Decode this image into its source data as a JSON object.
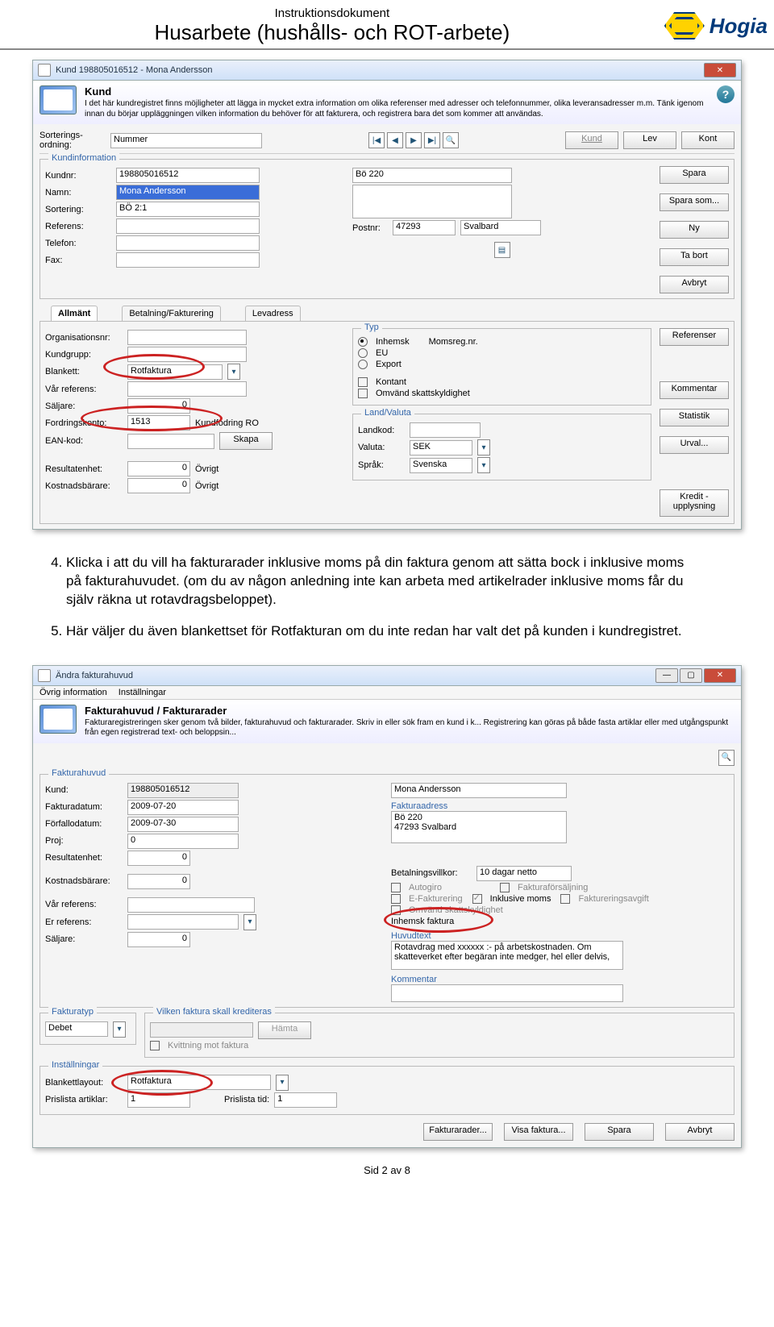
{
  "header": {
    "small": "Instruktionsdokument",
    "big": "Husarbete (hushålls- och ROT-arbete)",
    "brand": "Hogia"
  },
  "body": {
    "item4": "Klicka i att du vill ha fakturarader inklusive moms på din faktura genom att sätta bock i inklusive moms på fakturahuvudet. (om du av någon anledning inte kan arbeta med artikelrader inklusive moms får du själv räkna ut rotavdragsbeloppet).",
    "item5": "Här väljer du även blankettset för Rotfakturan om du inte redan har valt det på kunden i kundregistret."
  },
  "win1": {
    "title": "Kund 198805016512 - Mona Andersson",
    "info_h": "Kund",
    "info_p": "I det här kundregistret finns möjligheter att lägga in mycket extra information om olika referenser med adresser och telefonnummer, olika leveransadresser m.m. Tänk igenom innan du börjar uppläggningen vilken information du behöver för att fakturera, och registrera bara det som kommer att användas.",
    "sort_label": "Sorterings-\nordning:",
    "sort_val": "Nummer",
    "btn_kund": "Kund",
    "btn_lev": "Lev",
    "btn_kont": "Kont",
    "kundinfo": "Kundinformation",
    "kundnr_l": "Kundnr:",
    "kundnr_v": "198805016512",
    "namn_l": "Namn:",
    "namn_v": "Mona Andersson",
    "sortering_l": "Sortering:",
    "sortering_v": "BÖ 2:1",
    "referens_l": "Referens:",
    "telefon_l": "Telefon:",
    "postnr_l": "Postnr:",
    "postnr_v": "47293",
    "post_ort": "Svalbard",
    "fax_l": "Fax:",
    "addr1": "Bö 220",
    "btn_spara": "Spara",
    "btn_spara_som": "Spara som...",
    "btn_ny": "Ny",
    "btn_tabort": "Ta bort",
    "btn_avbryt": "Avbryt",
    "btn_referenser": "Referenser",
    "btn_kommentar": "Kommentar",
    "btn_statistik": "Statistik",
    "btn_urval": "Urval...",
    "btn_kredit": "Kredit -\nupplysning",
    "tab_allmant": "Allmänt",
    "tab_bet": "Betalning/Fakturering",
    "tab_levadr": "Levadress",
    "org_l": "Organisationsnr:",
    "kundgrupp_l": "Kundgrupp:",
    "blankett_l": "Blankett:",
    "blankett_v": "Rotfaktura",
    "varref_l": "Vår referens:",
    "saljare_l": "Säljare:",
    "saljare_v": "0",
    "fordring_l": "Fordringskonto:",
    "fordring_v": "1513",
    "fordring_t": "Kundfodring RO",
    "ean_l": "EAN-kod:",
    "btn_skapa": "Skapa",
    "resultat_l": "Resultatenhet:",
    "resultat_v": "0",
    "ovrigt": "Övrigt",
    "kostnad_l": "Kostnadsbärare:",
    "kostnad_v": "0",
    "typ_legend": "Typ",
    "r_inhemsk": "Inhemsk",
    "r_eu": "EU",
    "r_export": "Export",
    "momsreg": "Momsreg.nr.",
    "chk_kontant": "Kontant",
    "chk_omv": "Omvänd skattskyldighet",
    "land_legend": "Land/Valuta",
    "landkod_l": "Landkod:",
    "valuta_l": "Valuta:",
    "valuta_v": "SEK",
    "sprak_l": "Språk:",
    "sprak_v": "Svenska"
  },
  "win2": {
    "title": "Ändra fakturahuvud",
    "menu1": "Övrig information",
    "menu2": "Inställningar",
    "info_h": "Fakturahuvud / Fakturarader",
    "info_p": "Fakturaregistreringen sker genom två bilder, fakturahuvud och fakturarader. Skriv in eller sök fram en kund i k... Registrering kan göras på både fasta artiklar eller med utgångspunkt från egen registrerad text- och beloppsin...",
    "fh_legend": "Fakturahuvud",
    "kund_l": "Kund:",
    "kund_v": "198805016512",
    "kund_namn": "Mona Andersson",
    "fdat_l": "Fakturadatum:",
    "fdat_v": "2009-07-20",
    "ffdat_l": "Förfallodatum:",
    "ffdat_v": "2009-07-30",
    "proj_l": "Proj:",
    "proj_v": "0",
    "resultat_l": "Resultatenhet:",
    "resultat_v": "0",
    "kostnad_l": "Kostnadsbärare:",
    "kostnad_v": "0",
    "varref_l": "Vår referens:",
    "erref_l": "Er referens:",
    "saljare_l": "Säljare:",
    "saljare_v": "0",
    "faktadr_l": "Fakturaadress",
    "faktadr_v": "Bö 220\n47293 Svalbard",
    "betv_l": "Betalningsvillkor:",
    "betv_v": "10 dagar netto",
    "c_autogiro": "Autogiro",
    "c_efakt": "E-Fakturering",
    "c_inkl": "Inklusive moms",
    "c_omv": "Omvänd skattskyldighet",
    "c_ffors": "Fakturaförsäljning",
    "c_favg": "Faktureringsavgift",
    "inhemsk": "Inhemsk faktura",
    "huvudtext_l": "Huvudtext",
    "huvudtext_v": "Rotavdrag med xxxxxx :- på arbetskostnaden. Om skatteverket efter begäran inte medger, hel eller delvis,",
    "kommentar_l": "Kommentar",
    "ftyp_legend": "Fakturatyp",
    "ftyp_v": "Debet",
    "kred_l": "Vilken faktura skall krediteras",
    "btn_hamta": "Hämta",
    "c_kvitt": "Kvittning mot faktura",
    "inst_legend": "Inställningar",
    "blay_l": "Blankettlayout:",
    "blay_v": "Rotfaktura",
    "part_l": "Prislista artiklar:",
    "part_v": "1",
    "ptid_l": "Prislista tid:",
    "ptid_v": "1",
    "b1": "Fakturarader...",
    "b2": "Visa faktura...",
    "b3": "Spara",
    "b4": "Avbryt"
  },
  "footer": "Sid 2 av 8"
}
